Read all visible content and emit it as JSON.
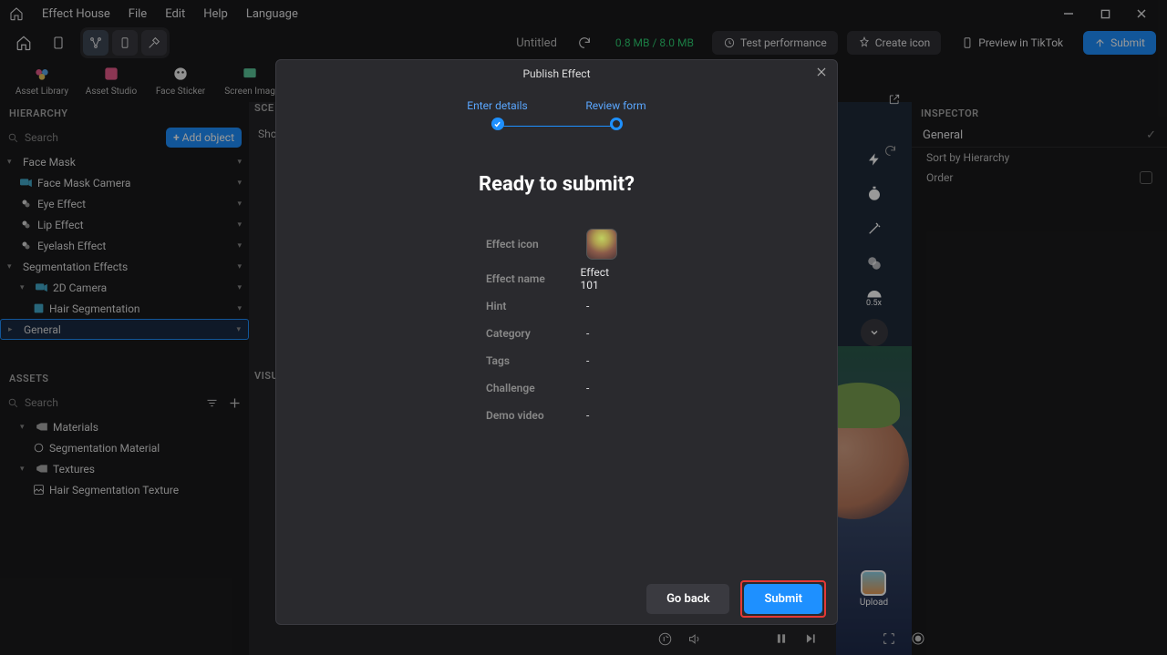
{
  "menu": {
    "app": "Effect House",
    "file": "File",
    "edit": "Edit",
    "help": "Help",
    "language": "Language"
  },
  "toolbar": {
    "project": "Untitled",
    "size": "0.8 MB / 8.0 MB",
    "test": "Test performance",
    "create_icon": "Create icon",
    "preview": "Preview in TikTok",
    "submit": "Submit"
  },
  "shortcuts": [
    {
      "label": "Asset Library"
    },
    {
      "label": "Asset Studio"
    },
    {
      "label": "Face Sticker"
    },
    {
      "label": "Screen Imag"
    }
  ],
  "hierarchy": {
    "title": "HIERARCHY",
    "search": "Search",
    "add": "Add object",
    "items": [
      {
        "label": "Face Mask",
        "indent": 0,
        "chev": "▾"
      },
      {
        "label": "Face Mask Camera",
        "indent": 1,
        "chev": ""
      },
      {
        "label": "Eye Effect",
        "indent": 1,
        "chev": ""
      },
      {
        "label": "Lip Effect",
        "indent": 1,
        "chev": ""
      },
      {
        "label": "Eyelash Effect",
        "indent": 1,
        "chev": ""
      },
      {
        "label": "Segmentation Effects",
        "indent": 0,
        "chev": "▾"
      },
      {
        "label": "2D Camera",
        "indent": 1,
        "chev": "▾"
      },
      {
        "label": "Hair Segmentation",
        "indent": 2,
        "chev": ""
      },
      {
        "label": "General",
        "indent": 0,
        "chev": "▸",
        "sel": true
      }
    ]
  },
  "assets": {
    "title": "ASSETS",
    "search": "Search",
    "items": [
      {
        "label": "Materials",
        "indent": 0,
        "chev": "▾"
      },
      {
        "label": "Segmentation Material",
        "indent": 1,
        "chev": ""
      },
      {
        "label": "Textures",
        "indent": 0,
        "chev": "▾"
      },
      {
        "label": "Hair Segmentation Texture",
        "indent": 1,
        "chev": ""
      }
    ]
  },
  "scene_label": "SCE",
  "visual_label": "VISU",
  "scene_show": "Sho",
  "inspector": {
    "title": "INSPECTOR",
    "general": "General",
    "sort": "Sort by Hierarchy",
    "order": "Order"
  },
  "preview": {
    "speed": "0.5x",
    "upload": "Upload"
  },
  "modal": {
    "title": "Publish Effect",
    "step1": "Enter details",
    "step2": "Review form",
    "heading": "Ready to submit?",
    "rows": {
      "icon": "Effect icon",
      "name_k": "Effect name",
      "name_v": "Effect 101",
      "hint_k": "Hint",
      "hint_v": "-",
      "cat_k": "Category",
      "cat_v": "-",
      "tags_k": "Tags",
      "tags_v": "-",
      "chal_k": "Challenge",
      "chal_v": "-",
      "demo_k": "Demo video",
      "demo_v": "-"
    },
    "back": "Go back",
    "submit": "Submit"
  }
}
